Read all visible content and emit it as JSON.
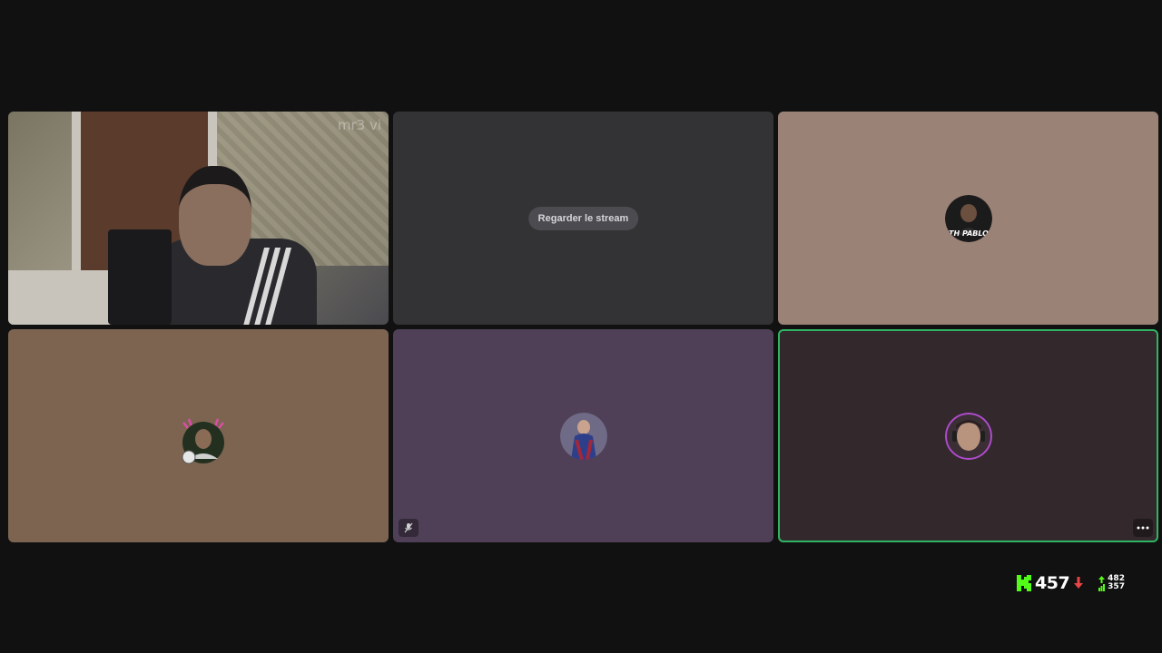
{
  "watermark": "mr3 vi",
  "stream_button_label": "Regarder le stream",
  "tiles": [
    {
      "id": "camera",
      "type": "video"
    },
    {
      "id": "stream",
      "type": "stream",
      "color": "#333335"
    },
    {
      "id": "th-pablo",
      "type": "avatar",
      "color": "#9a8276",
      "avatar_text": "TH PABLO"
    },
    {
      "id": "user-4",
      "type": "avatar",
      "color": "#7c6450"
    },
    {
      "id": "user-5",
      "type": "avatar",
      "color": "#4f4057",
      "muted": true
    },
    {
      "id": "user-6",
      "type": "avatar",
      "color": "#33292d",
      "speaking": true
    }
  ],
  "stats": {
    "viewer_count": "457",
    "trend": "down",
    "up_count": "482",
    "down_count": "357",
    "brand_color": "#53fc18",
    "down_color": "#e84545"
  },
  "icons": {
    "muted": "mic-off-icon",
    "more": "more-options-icon",
    "logo": "kick-logo-icon"
  }
}
